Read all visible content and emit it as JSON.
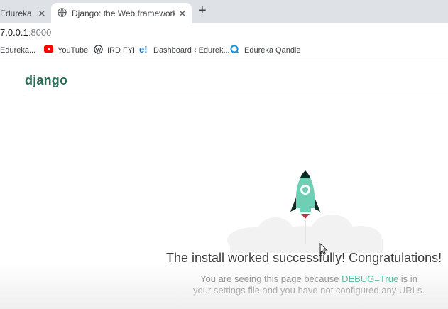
{
  "browser": {
    "tabs": [
      {
        "title": "Edureka..."
      },
      {
        "title": "Django: the Web framework for p"
      }
    ],
    "new_tab_label": "+",
    "close_label": "✕",
    "url": {
      "host": "7.0.0.1",
      "port": ":8000"
    },
    "bookmarks": [
      {
        "label": "Edureka...",
        "icon": "none"
      },
      {
        "label": "YouTube",
        "icon": "youtube-icon"
      },
      {
        "label": "IRD FYI",
        "icon": "wordpress-icon"
      },
      {
        "label": "Dashboard ‹ Edurek...",
        "icon": "edureka-e-icon"
      },
      {
        "label": "Edureka Qandle",
        "icon": "qandle-q-icon"
      }
    ]
  },
  "page": {
    "logo": "django",
    "headline": "The install worked successfully! Congratulations!",
    "subtext": {
      "before": "You are seeing this page because ",
      "debug": "DEBUG=True",
      "after": " is in your settings file and you have not configured any URLs."
    },
    "colors": {
      "logo": "#2c6e54",
      "rocket_body": "#6fcfb5",
      "debug_link": "#20a37f"
    }
  }
}
